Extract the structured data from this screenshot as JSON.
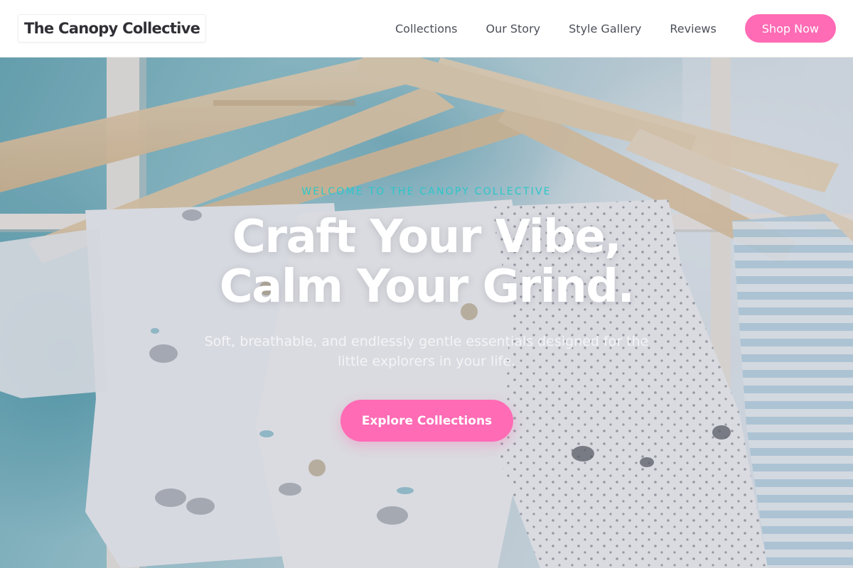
{
  "header": {
    "brand": "The Canopy Collective",
    "nav": [
      {
        "label": "Collections"
      },
      {
        "label": "Our Story"
      },
      {
        "label": "Style Gallery"
      },
      {
        "label": "Reviews"
      }
    ],
    "cta_label": "Shop Now"
  },
  "hero": {
    "eyebrow": "WELCOME TO THE CANOPY COLLECTIVE",
    "headline_line1": "Craft Your Vibe,",
    "headline_line2": "Calm Your Grind.",
    "subtitle": "Soft, breathable, and endlessly gentle essentials designed for the little explorers in your life.",
    "cta_label": "Explore Collections"
  },
  "colors": {
    "accent_pink": "#ff6bb5",
    "accent_teal": "#2cc7c9",
    "text_dark": "#2f2f35",
    "nav_text": "#4b4f59"
  }
}
